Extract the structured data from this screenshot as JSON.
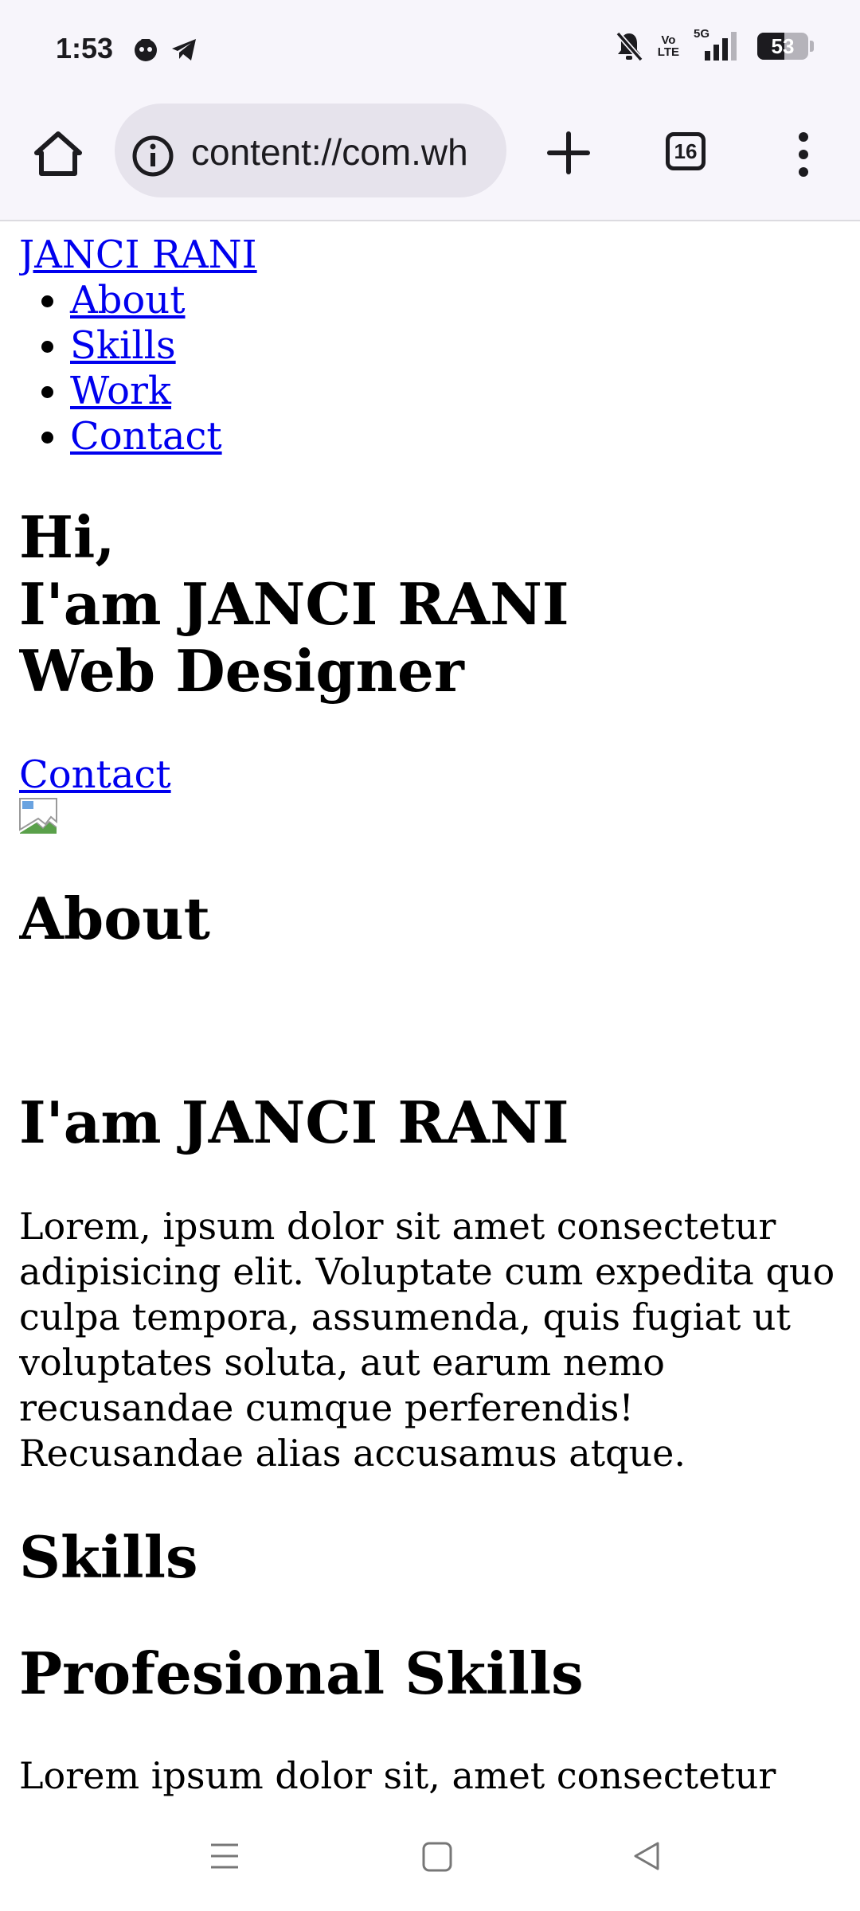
{
  "status_bar": {
    "time": "1:53",
    "network": "5G",
    "volte_top": "Vo",
    "volte_bottom": "LTE",
    "battery": "53",
    "battery_level": 0.53,
    "icons": [
      "app-notification-icon",
      "telegram-icon",
      "mute-icon",
      "volte-icon",
      "signal-icon",
      "battery-icon"
    ]
  },
  "browser": {
    "url": "content://com.wh",
    "tab_count": "16",
    "icons": [
      "home-icon",
      "site-info-icon",
      "new-tab-icon",
      "tab-switcher-icon",
      "more-menu-icon"
    ]
  },
  "page": {
    "brand": "JANCI RANI",
    "nav": [
      "About",
      "Skills",
      "Work",
      "Contact"
    ],
    "hero": {
      "line1": "Hi,",
      "line2": "I'am JANCI RANI",
      "line3": "Web Designer"
    },
    "contact_link": "Contact",
    "about_heading": "About",
    "about_subheading": "I'am JANCI RANI",
    "about_text": "Lorem, ipsum dolor sit amet consectetur adipisicing elit. Voluptate cum expedita quo culpa tempora, assumenda, quis fugiat ut voluptates soluta, aut earum nemo recusandae cumque perferendis! Recusandae alias accusamus atque.",
    "skills_heading": "Skills",
    "skills_subheading": "Profesional Skills",
    "skills_text": "Lorem ipsum dolor sit, amet consectetur"
  },
  "system_nav": {
    "icons": [
      "recents-icon",
      "home-icon",
      "back-icon"
    ]
  },
  "colors": {
    "link": "#0000ee",
    "chrome_bg": "#f7f5fb",
    "url_pill": "#e6e3ec"
  }
}
